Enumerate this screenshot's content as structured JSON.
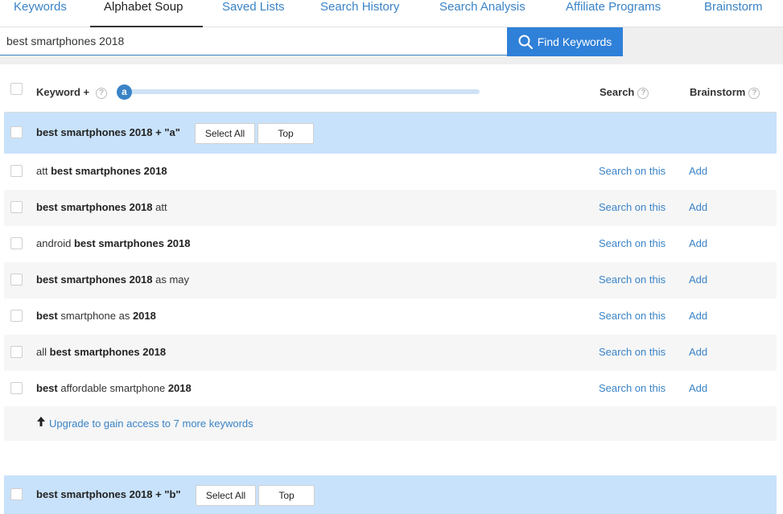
{
  "tabs": [
    {
      "label": "Keywords",
      "active": false
    },
    {
      "label": "Alphabet Soup",
      "active": true
    },
    {
      "label": "Saved Lists",
      "active": false
    },
    {
      "label": "Search History",
      "active": false
    },
    {
      "label": "Search Analysis",
      "active": false
    },
    {
      "label": "Affiliate Programs",
      "active": false
    },
    {
      "label": "Brainstorm",
      "active": false
    }
  ],
  "search": {
    "value": "best smartphones 2018",
    "button_label": "Find Keywords",
    "button_icon": "search-icon"
  },
  "header": {
    "keyword_label": "Keyword +",
    "slider_letter": "a",
    "search_label": "Search",
    "brainstorm_label": "Brainstorm",
    "help_glyph": "?"
  },
  "groups": [
    {
      "title": "best smartphones 2018 + \"a\"",
      "select_all": "Select All",
      "top": "Top"
    },
    {
      "title": "best smartphones 2018 + \"b\"",
      "select_all": "Select All",
      "top": "Top"
    }
  ],
  "rows": [
    {
      "parts": [
        {
          "t": "att ",
          "b": false
        },
        {
          "t": "best smartphones 2018",
          "b": true
        }
      ],
      "search_action": "Search on this",
      "add_action": "Add"
    },
    {
      "parts": [
        {
          "t": "best smartphones 2018",
          "b": true
        },
        {
          "t": " att",
          "b": false
        }
      ],
      "search_action": "Search on this",
      "add_action": "Add"
    },
    {
      "parts": [
        {
          "t": "android ",
          "b": false
        },
        {
          "t": "best smartphones 2018",
          "b": true
        }
      ],
      "search_action": "Search on this",
      "add_action": "Add"
    },
    {
      "parts": [
        {
          "t": "best smartphones 2018",
          "b": true
        },
        {
          "t": " as may",
          "b": false
        }
      ],
      "search_action": "Search on this",
      "add_action": "Add"
    },
    {
      "parts": [
        {
          "t": "best",
          "b": true
        },
        {
          "t": " smartphone as ",
          "b": false
        },
        {
          "t": "2018",
          "b": true
        }
      ],
      "search_action": "Search on this",
      "add_action": "Add"
    },
    {
      "parts": [
        {
          "t": "all ",
          "b": false
        },
        {
          "t": "best smartphones 2018",
          "b": true
        }
      ],
      "search_action": "Search on this",
      "add_action": "Add"
    },
    {
      "parts": [
        {
          "t": "best",
          "b": true
        },
        {
          "t": " affordable smartphone ",
          "b": false
        },
        {
          "t": "2018",
          "b": true
        }
      ],
      "search_action": "Search on this",
      "add_action": "Add"
    }
  ],
  "upgrade": {
    "text": "Upgrade to gain access to 7 more keywords",
    "arrow_icon": "arrow-up-icon"
  },
  "colors": {
    "accent": "#3a83c6",
    "button_blue": "#2f80d8",
    "group_bg": "#c8e2fb",
    "row_alt_bg": "#f6f6f6"
  }
}
